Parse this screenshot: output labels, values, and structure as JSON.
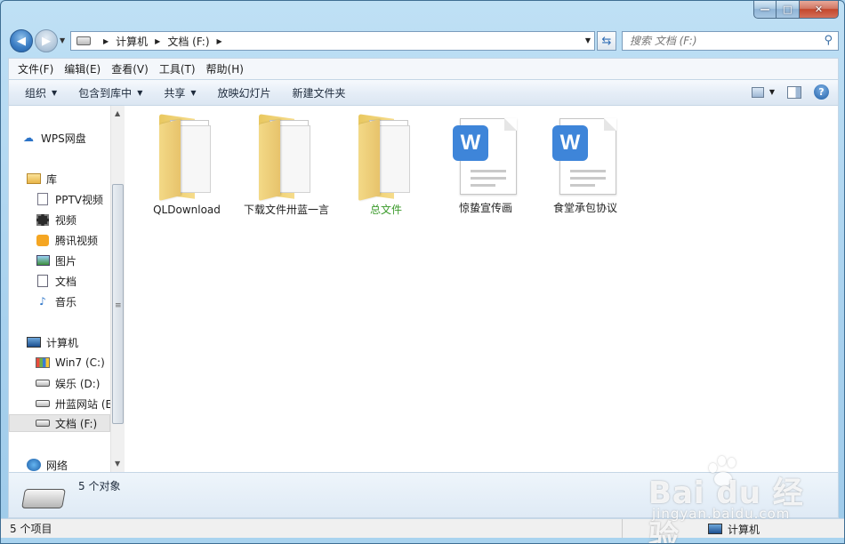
{
  "window": {
    "caption": {
      "minimize": "—",
      "maximize": "□",
      "close": "✕"
    }
  },
  "nav": {
    "back_icon": "arrow-left-icon",
    "forward_icon": "arrow-right-icon",
    "breadcrumb": [
      "计算机",
      "文档 (F:)"
    ],
    "search_placeholder": "搜索 文档 (F:)"
  },
  "menubar": {
    "items": [
      "文件(F)",
      "编辑(E)",
      "查看(V)",
      "工具(T)",
      "帮助(H)"
    ]
  },
  "commandbar": {
    "organize": "组织",
    "include_in_library": "包含到库中",
    "share": "共享",
    "slideshow": "放映幻灯片",
    "new_folder": "新建文件夹"
  },
  "sidebar": {
    "items": [
      {
        "label": "WPS网盘",
        "icon": "cloud-icon"
      },
      {
        "label": "库",
        "icon": "library-icon"
      },
      {
        "label": "PPTV视频",
        "icon": "pptv-icon"
      },
      {
        "label": "视频",
        "icon": "video-icon"
      },
      {
        "label": "腾讯视频",
        "icon": "tencent-video-icon"
      },
      {
        "label": "图片",
        "icon": "picture-icon"
      },
      {
        "label": "文档",
        "icon": "document-icon"
      },
      {
        "label": "音乐",
        "icon": "music-icon"
      },
      {
        "label": "计算机",
        "icon": "computer-icon"
      },
      {
        "label": "Win7 (C:)",
        "icon": "windows-drive-icon"
      },
      {
        "label": "娱乐 (D:)",
        "icon": "drive-icon"
      },
      {
        "label": "卅蓝网站 (E",
        "icon": "drive-icon"
      },
      {
        "label": "文档 (F:)",
        "icon": "drive-icon"
      },
      {
        "label": "网络",
        "icon": "network-icon"
      }
    ]
  },
  "files": [
    {
      "name": "QLDownload",
      "type": "folder"
    },
    {
      "name": "下载文件卅蓝一言",
      "type": "folder"
    },
    {
      "name": "总文件",
      "type": "folder",
      "color": "#3a9a2a"
    },
    {
      "name": "惊蛰宣传画",
      "type": "wps-doc"
    },
    {
      "name": "食堂承包协议",
      "type": "wps-doc"
    }
  ],
  "wps_badge": "W",
  "details": {
    "count_text": "5 个对象"
  },
  "statusbar": {
    "items_text": "5 个项目",
    "location": "计算机"
  },
  "watermark": {
    "brand": "Bai du 经验",
    "url": "jingyan.baidu.com"
  },
  "colors": {
    "accent": "#3e85d9",
    "folder": "#f3d987",
    "green_label": "#3a9a2a"
  }
}
